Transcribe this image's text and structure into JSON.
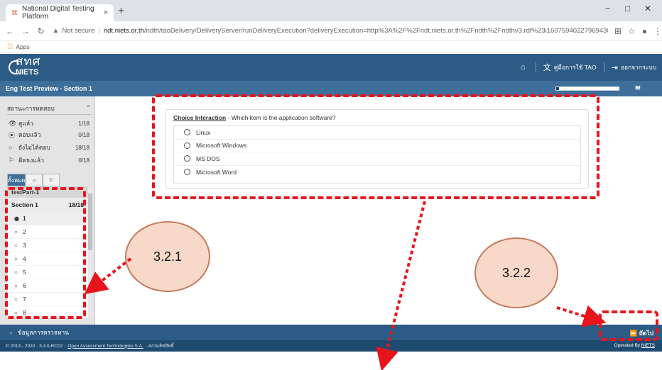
{
  "browser": {
    "tab_title": "National Digital Testing Platform",
    "tab_close": "×",
    "new_tab": "+",
    "win_min": "−",
    "win_max": "□",
    "win_close": "✕",
    "not_secure": "Not secure",
    "url_host": "ndt.niets.or.th",
    "url_path": "/ndth/taoDelivery/DeliveryServer/runDeliveryExecution?deliveryExecution=http%3A%2F%2Fndt.niets.or.th%2Fndth%2Fndthv3.rdf%23i160759402279694308",
    "apps_label": "Apps"
  },
  "header": {
    "logo_top": "สทศ",
    "logo_bottom": "NIETS",
    "home_icon": "home-icon",
    "manual_label": "คู่มือการใช้ TAO",
    "logout_label": "ออกจากระบบ"
  },
  "subheader": {
    "title": "Eng Test Preview - Section 1",
    "progress_fraction": 0.05
  },
  "status_panel": {
    "title": "สถานะการทดสอบ",
    "rows": [
      {
        "icon": "👁",
        "label": "ดูแล้ว",
        "count": "1/18"
      },
      {
        "icon": "⦿",
        "label": "ตอบแล้ว",
        "count": "0/18"
      },
      {
        "icon": "○",
        "label": "ยังไม่ได้ตอบ",
        "count": "18/18"
      },
      {
        "icon": "⚐",
        "label": "ติดธงแล้ว",
        "count": "0/18"
      }
    ],
    "filters": [
      "ทั้งหมด",
      "○",
      "⚐"
    ],
    "part_label": "testPart-1",
    "section_label": "Section 1",
    "section_count": "18/18",
    "items": [
      "1",
      "2",
      "3",
      "4",
      "5",
      "6",
      "7",
      "8"
    ]
  },
  "question": {
    "type_label": "Choice Interaction",
    "prompt": " - Which item is the application software?",
    "choices": [
      "Linux",
      "Microsoft Windows",
      "MS DOS",
      "Microsoft Word"
    ]
  },
  "footer": {
    "back_label": "ข้อมูลการตรวจหาน",
    "next_label": "ถัดไป",
    "copyright": "© 2013 - 2020 · 3.3.0-RC02 ·",
    "company": "Open Assessment Technologies S.A.",
    "rights": "· สงวนลิขสิทธิ์",
    "operated": "Operated By",
    "operated_by": "NIETS"
  },
  "annotations": {
    "label_1": "3.2.1",
    "label_2": "3.2.2",
    "color": "#e8141c"
  }
}
